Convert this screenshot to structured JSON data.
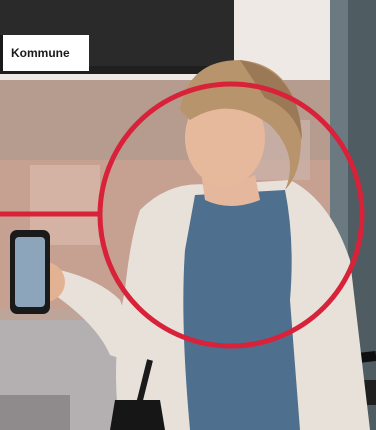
{
  "badge": {
    "label": "Kommune"
  },
  "colors": {
    "accent": "#d8223a",
    "badge_bg": "#ffffff",
    "badge_text": "#1a1a1a"
  },
  "hero": {
    "icon": "woman-on-bus-photo"
  }
}
